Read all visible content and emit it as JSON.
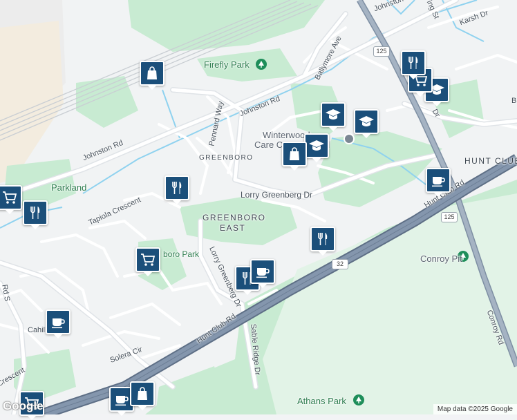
{
  "map": {
    "colors": {
      "park": "#c8ebd2",
      "water": "#8fd2ef",
      "highway": "#8a9bb0",
      "highway_casing": "#6f8198",
      "arterial": "#ffffff",
      "marker": "#1b4f7a",
      "tree_icon": "#1e8e5a"
    },
    "labels": {
      "firefly_park": "Firefly Park",
      "johnston_rd_north": "Johnston Rd",
      "johnston_rd_west": "Johnston Rd",
      "pennard_way": "Pennard Way",
      "ballymore_ave": "Ballymore Ave",
      "karsh_dr": "Karsh Dr",
      "greenboro_small": "GREENBORO",
      "winterwood_line1": "Winterwood",
      "winterwood_line2": "Care Centre, Mobil",
      "parkland": "Parkland",
      "tapiola_crescent": "Tapiola Crescent",
      "lorry_greenberg_dr": "Lorry Greenberg Dr",
      "greenboro_east_1": "GREENBORO",
      "greenboro_east_2": "EAST",
      "hunt_club_top": "HUNT CLUB",
      "hunt_club_rd_east": "Hunt Club Rd",
      "lorry_greenberg_dr_vertical": "Lorry Greenberg Dr",
      "greenboro_park_fragment": "boro Park",
      "conroy_pit": "Conroy Pit",
      "cahill": "Cahill",
      "rd_s": "Rd S",
      "crescent_left": "Crescent",
      "solera_cir": "Solera Cir",
      "hunt_club_rd_south": "Hunt Club Rd",
      "sable_ridge_dr": "Sable Ridge Dr",
      "conroy_rd": "Conroy Rd",
      "athans_park": "Athans Park",
      "johnston_top_fragment": "Johnston",
      "ing_st": "ing St",
      "dr_fragment_right": "Dr",
      "b_fragment": "B"
    },
    "shields": {
      "route_125_top": "125",
      "route_125_mid": "125",
      "route_32": "32"
    },
    "markers": [
      {
        "icon": "shopping-bag-icon"
      },
      {
        "icon": "restaurant-icon"
      },
      {
        "icon": "shopping-cart-icon"
      },
      {
        "icon": "school-icon"
      },
      {
        "icon": "school-icon"
      },
      {
        "icon": "school-icon"
      },
      {
        "icon": "shopping-bag-icon"
      },
      {
        "icon": "school-icon"
      },
      {
        "icon": "coffee-icon"
      },
      {
        "icon": "shopping-cart-icon"
      },
      {
        "icon": "restaurant-icon"
      },
      {
        "icon": "restaurant-icon"
      },
      {
        "icon": "restaurant-icon"
      },
      {
        "icon": "shopping-cart-icon"
      },
      {
        "icon": "restaurant-icon"
      },
      {
        "icon": "coffee-icon"
      },
      {
        "icon": "coffee-icon"
      },
      {
        "icon": "coffee-icon"
      },
      {
        "icon": "shopping-bag-icon"
      },
      {
        "icon": "shopping-cart-icon"
      }
    ],
    "attribution": "Map data ©2025 Google",
    "logo": "Google"
  }
}
